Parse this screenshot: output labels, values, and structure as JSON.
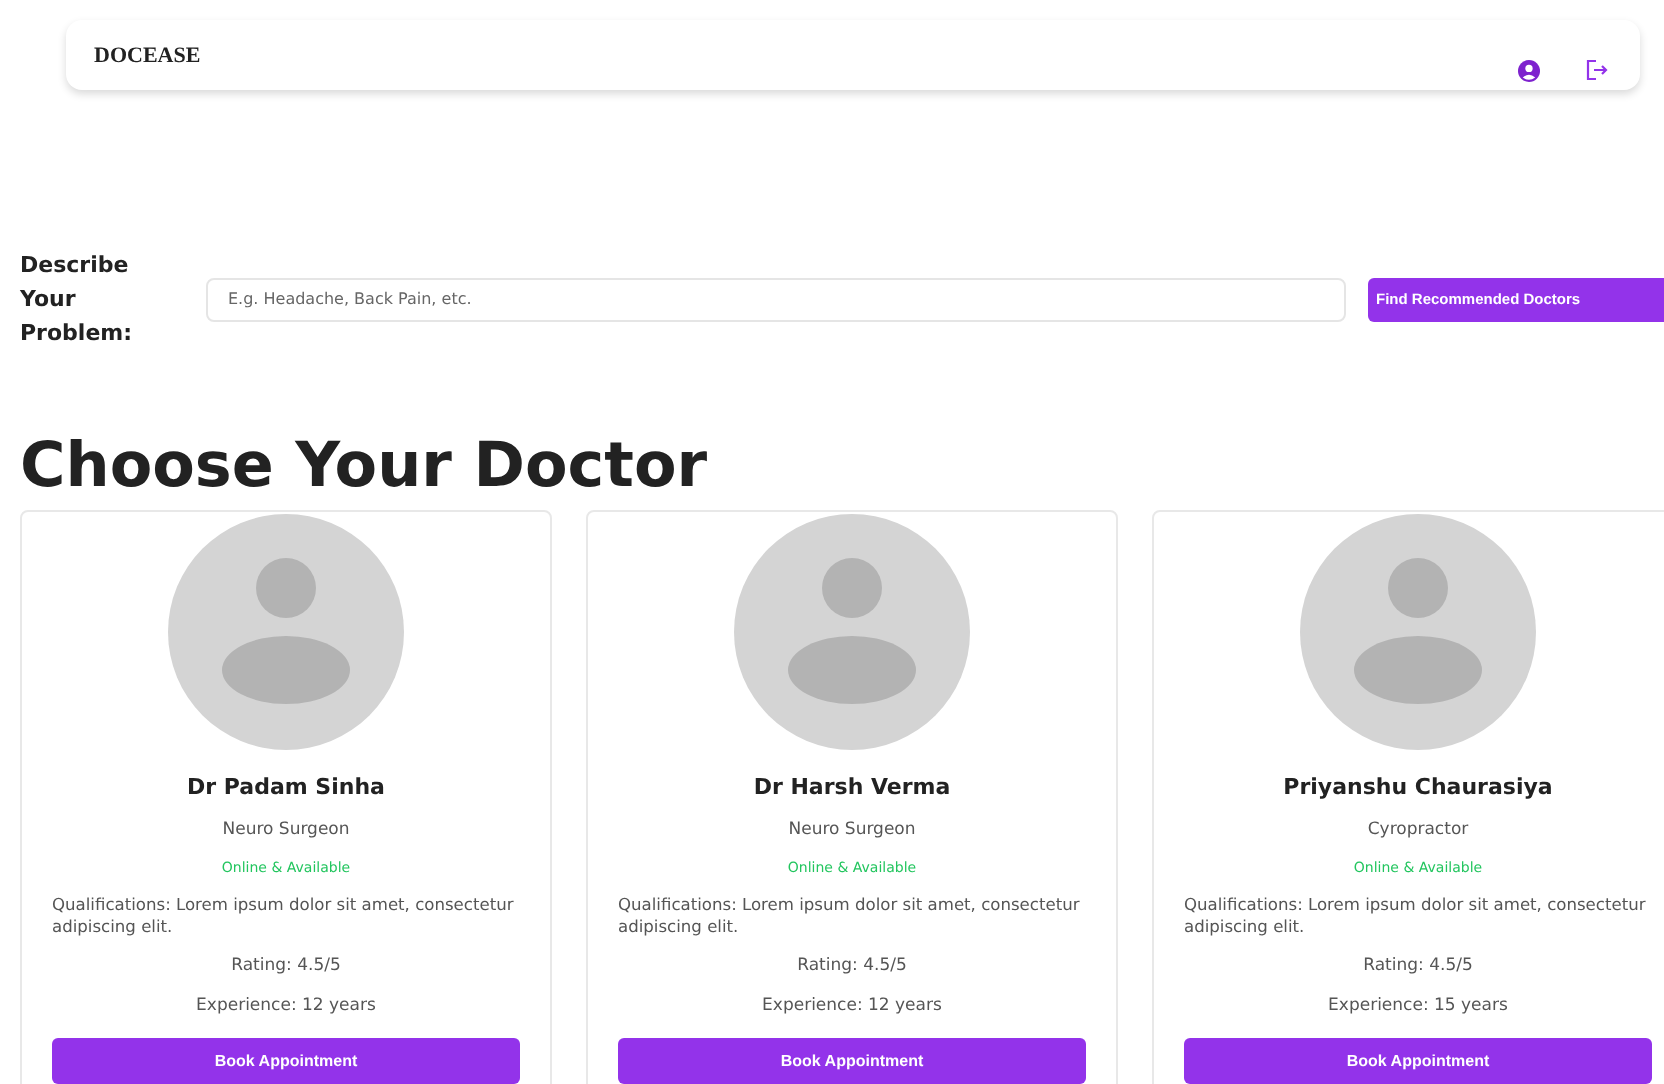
{
  "nav": {
    "brand": "DOCEASE"
  },
  "search": {
    "label": "Describe Your Problem:",
    "placeholder": "E.g. Headache, Back Pain, etc.",
    "button": "Find Recommended Doctors"
  },
  "heading": "Choose Your Doctor",
  "doctors": [
    {
      "name": "Dr Padam Sinha",
      "specialty": "Neuro Surgeon",
      "status": "Online & Available",
      "qualifications": "Qualifications: Lorem ipsum dolor sit amet, consectetur adipiscing elit.",
      "rating": "Rating: 4.5/5",
      "experience": "Experience: 12 years",
      "button": "Book Appointment"
    },
    {
      "name": "Dr Harsh Verma",
      "specialty": "Neuro Surgeon",
      "status": "Online & Available",
      "qualifications": "Qualifications: Lorem ipsum dolor sit amet, consectetur adipiscing elit.",
      "rating": "Rating: 4.5/5",
      "experience": "Experience: 12 years",
      "button": "Book Appointment"
    },
    {
      "name": "Priyanshu Chaurasiya",
      "specialty": "Cyropractor",
      "status": "Online & Available",
      "qualifications": "Qualifications: Lorem ipsum dolor sit amet, consectetur adipiscing elit.",
      "rating": "Rating: 4.5/5",
      "experience": "Experience: 15 years",
      "button": "Book Appointment"
    }
  ]
}
